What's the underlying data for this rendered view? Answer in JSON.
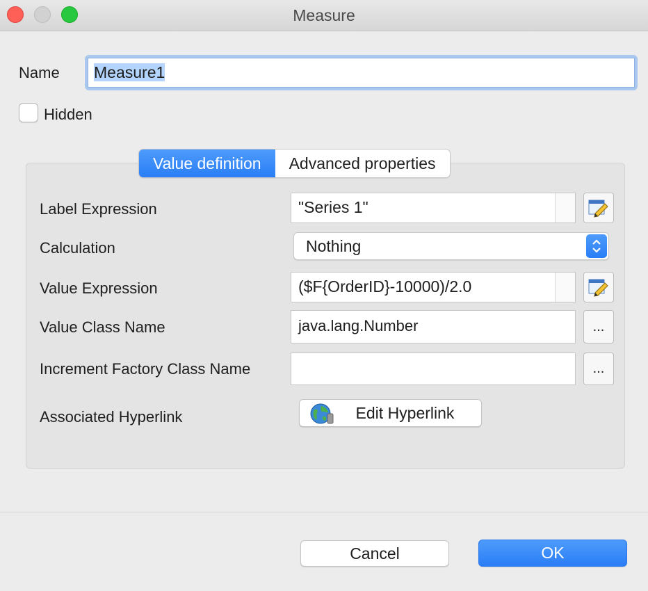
{
  "window": {
    "title": "Measure"
  },
  "name": {
    "label": "Name",
    "value": "Measure1"
  },
  "hidden": {
    "label": "Hidden",
    "checked": false
  },
  "tabs": [
    {
      "label": "Value definition",
      "active": true
    },
    {
      "label": "Advanced properties",
      "active": false
    }
  ],
  "form": {
    "label_expression": {
      "label": "Label Expression",
      "value": "\"Series 1\""
    },
    "calculation": {
      "label": "Calculation",
      "value": "Nothing"
    },
    "value_expression": {
      "label": "Value Expression",
      "value": "($F{OrderID}-10000)/2.0"
    },
    "value_class_name": {
      "label": "Value Class Name",
      "value": "java.lang.Number"
    },
    "increment_factory": {
      "label": "Increment Factory Class Name",
      "value": ""
    },
    "hyperlink": {
      "label": "Associated Hyperlink",
      "button_label": "Edit Hyperlink"
    },
    "ellipsis": "..."
  },
  "buttons": {
    "cancel": "Cancel",
    "ok": "OK"
  },
  "colors": {
    "accent": "#2a7ef6",
    "selection": "#b3d4fc"
  }
}
